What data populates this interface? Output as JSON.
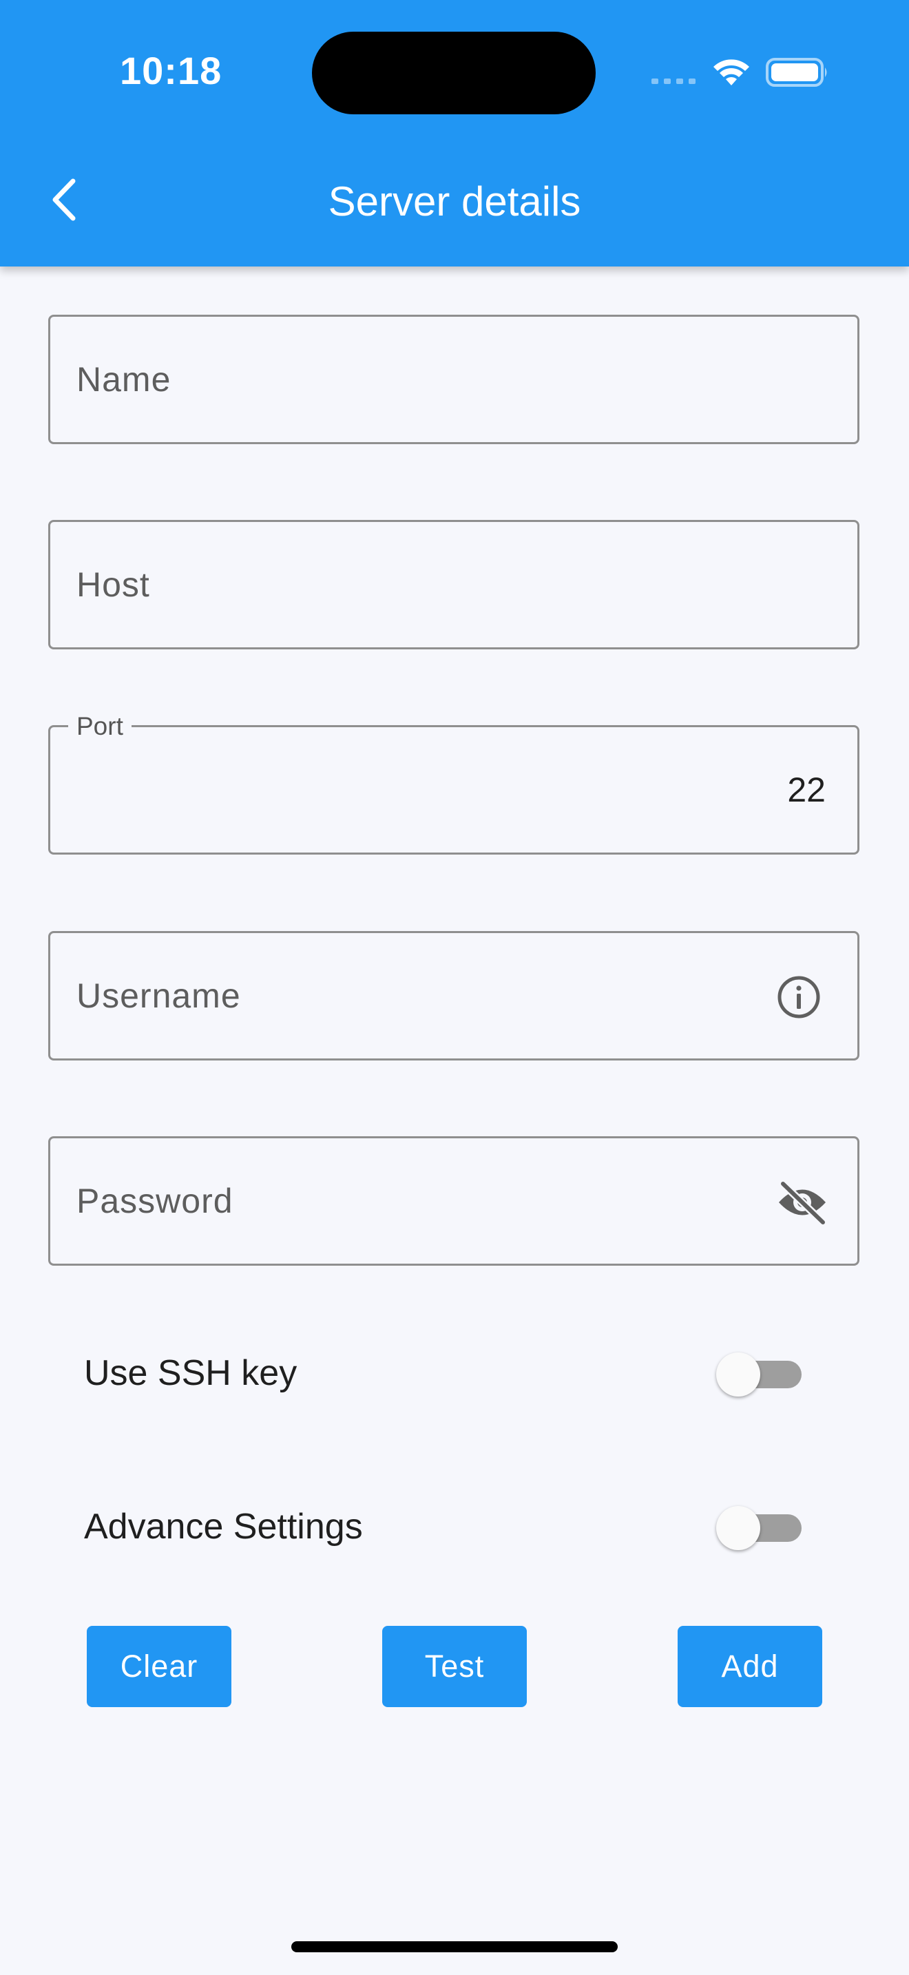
{
  "status_bar": {
    "time": "10:18",
    "icons": [
      "cellular-signal-icon",
      "wifi-icon",
      "battery-icon"
    ]
  },
  "app_bar": {
    "back_icon": "chevron-left-icon",
    "title": "Server details",
    "color": "#2196f3"
  },
  "form": {
    "name": {
      "placeholder": "Name",
      "value": ""
    },
    "host": {
      "placeholder": "Host",
      "value": ""
    },
    "port": {
      "label": "Port",
      "value": "22"
    },
    "username": {
      "placeholder": "Username",
      "value": "",
      "trailing_icon": "info-icon"
    },
    "password": {
      "placeholder": "Password",
      "value": "",
      "trailing_icon": "visibility-off-icon"
    }
  },
  "toggles": {
    "ssh_key": {
      "label": "Use SSH key",
      "on": false
    },
    "advance_settings": {
      "label": "Advance Settings",
      "on": false
    }
  },
  "buttons": {
    "clear": "Clear",
    "test": "Test",
    "add": "Add"
  }
}
